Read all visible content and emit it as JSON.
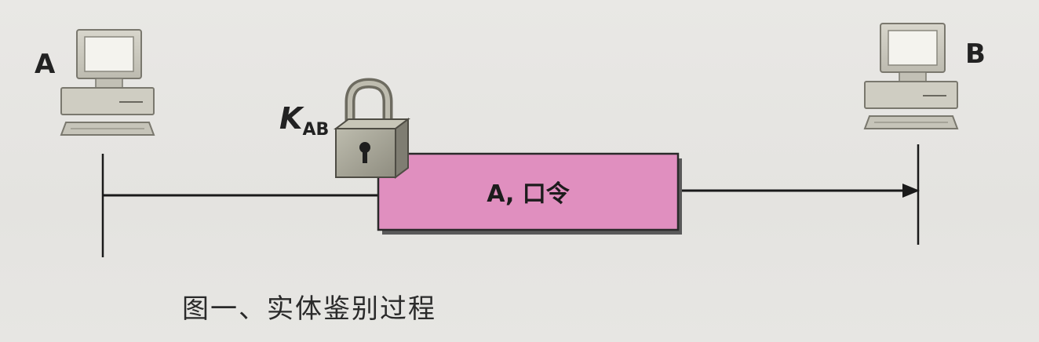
{
  "hosts": {
    "a": {
      "label": "A",
      "icon": "computer-icon"
    },
    "b": {
      "label": "B",
      "icon": "computer-icon"
    }
  },
  "key": {
    "main": "K",
    "sub": "AB",
    "icon": "padlock-icon"
  },
  "message": {
    "text": "A, 口令"
  },
  "caption": "图一、实体鉴别过程",
  "colors": {
    "message_fill": "#e08fbf",
    "computer_body": "#c9c7bd",
    "padlock_body": "#aaa89a",
    "line": "#1a1a1a"
  }
}
